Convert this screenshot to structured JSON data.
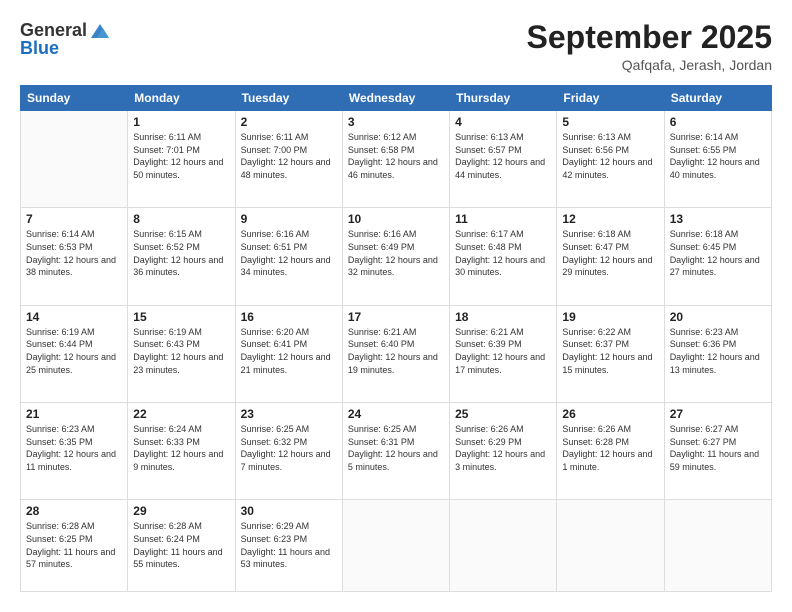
{
  "logo": {
    "general": "General",
    "blue": "Blue"
  },
  "header": {
    "month_year": "September 2025",
    "location": "Qafqafa, Jerash, Jordan"
  },
  "weekdays": [
    "Sunday",
    "Monday",
    "Tuesday",
    "Wednesday",
    "Thursday",
    "Friday",
    "Saturday"
  ],
  "weeks": [
    [
      {
        "day": "",
        "sunrise": "",
        "sunset": "",
        "daylight": ""
      },
      {
        "day": "1",
        "sunrise": "Sunrise: 6:11 AM",
        "sunset": "Sunset: 7:01 PM",
        "daylight": "Daylight: 12 hours and 50 minutes."
      },
      {
        "day": "2",
        "sunrise": "Sunrise: 6:11 AM",
        "sunset": "Sunset: 7:00 PM",
        "daylight": "Daylight: 12 hours and 48 minutes."
      },
      {
        "day": "3",
        "sunrise": "Sunrise: 6:12 AM",
        "sunset": "Sunset: 6:58 PM",
        "daylight": "Daylight: 12 hours and 46 minutes."
      },
      {
        "day": "4",
        "sunrise": "Sunrise: 6:13 AM",
        "sunset": "Sunset: 6:57 PM",
        "daylight": "Daylight: 12 hours and 44 minutes."
      },
      {
        "day": "5",
        "sunrise": "Sunrise: 6:13 AM",
        "sunset": "Sunset: 6:56 PM",
        "daylight": "Daylight: 12 hours and 42 minutes."
      },
      {
        "day": "6",
        "sunrise": "Sunrise: 6:14 AM",
        "sunset": "Sunset: 6:55 PM",
        "daylight": "Daylight: 12 hours and 40 minutes."
      }
    ],
    [
      {
        "day": "7",
        "sunrise": "Sunrise: 6:14 AM",
        "sunset": "Sunset: 6:53 PM",
        "daylight": "Daylight: 12 hours and 38 minutes."
      },
      {
        "day": "8",
        "sunrise": "Sunrise: 6:15 AM",
        "sunset": "Sunset: 6:52 PM",
        "daylight": "Daylight: 12 hours and 36 minutes."
      },
      {
        "day": "9",
        "sunrise": "Sunrise: 6:16 AM",
        "sunset": "Sunset: 6:51 PM",
        "daylight": "Daylight: 12 hours and 34 minutes."
      },
      {
        "day": "10",
        "sunrise": "Sunrise: 6:16 AM",
        "sunset": "Sunset: 6:49 PM",
        "daylight": "Daylight: 12 hours and 32 minutes."
      },
      {
        "day": "11",
        "sunrise": "Sunrise: 6:17 AM",
        "sunset": "Sunset: 6:48 PM",
        "daylight": "Daylight: 12 hours and 30 minutes."
      },
      {
        "day": "12",
        "sunrise": "Sunrise: 6:18 AM",
        "sunset": "Sunset: 6:47 PM",
        "daylight": "Daylight: 12 hours and 29 minutes."
      },
      {
        "day": "13",
        "sunrise": "Sunrise: 6:18 AM",
        "sunset": "Sunset: 6:45 PM",
        "daylight": "Daylight: 12 hours and 27 minutes."
      }
    ],
    [
      {
        "day": "14",
        "sunrise": "Sunrise: 6:19 AM",
        "sunset": "Sunset: 6:44 PM",
        "daylight": "Daylight: 12 hours and 25 minutes."
      },
      {
        "day": "15",
        "sunrise": "Sunrise: 6:19 AM",
        "sunset": "Sunset: 6:43 PM",
        "daylight": "Daylight: 12 hours and 23 minutes."
      },
      {
        "day": "16",
        "sunrise": "Sunrise: 6:20 AM",
        "sunset": "Sunset: 6:41 PM",
        "daylight": "Daylight: 12 hours and 21 minutes."
      },
      {
        "day": "17",
        "sunrise": "Sunrise: 6:21 AM",
        "sunset": "Sunset: 6:40 PM",
        "daylight": "Daylight: 12 hours and 19 minutes."
      },
      {
        "day": "18",
        "sunrise": "Sunrise: 6:21 AM",
        "sunset": "Sunset: 6:39 PM",
        "daylight": "Daylight: 12 hours and 17 minutes."
      },
      {
        "day": "19",
        "sunrise": "Sunrise: 6:22 AM",
        "sunset": "Sunset: 6:37 PM",
        "daylight": "Daylight: 12 hours and 15 minutes."
      },
      {
        "day": "20",
        "sunrise": "Sunrise: 6:23 AM",
        "sunset": "Sunset: 6:36 PM",
        "daylight": "Daylight: 12 hours and 13 minutes."
      }
    ],
    [
      {
        "day": "21",
        "sunrise": "Sunrise: 6:23 AM",
        "sunset": "Sunset: 6:35 PM",
        "daylight": "Daylight: 12 hours and 11 minutes."
      },
      {
        "day": "22",
        "sunrise": "Sunrise: 6:24 AM",
        "sunset": "Sunset: 6:33 PM",
        "daylight": "Daylight: 12 hours and 9 minutes."
      },
      {
        "day": "23",
        "sunrise": "Sunrise: 6:25 AM",
        "sunset": "Sunset: 6:32 PM",
        "daylight": "Daylight: 12 hours and 7 minutes."
      },
      {
        "day": "24",
        "sunrise": "Sunrise: 6:25 AM",
        "sunset": "Sunset: 6:31 PM",
        "daylight": "Daylight: 12 hours and 5 minutes."
      },
      {
        "day": "25",
        "sunrise": "Sunrise: 6:26 AM",
        "sunset": "Sunset: 6:29 PM",
        "daylight": "Daylight: 12 hours and 3 minutes."
      },
      {
        "day": "26",
        "sunrise": "Sunrise: 6:26 AM",
        "sunset": "Sunset: 6:28 PM",
        "daylight": "Daylight: 12 hours and 1 minute."
      },
      {
        "day": "27",
        "sunrise": "Sunrise: 6:27 AM",
        "sunset": "Sunset: 6:27 PM",
        "daylight": "Daylight: 11 hours and 59 minutes."
      }
    ],
    [
      {
        "day": "28",
        "sunrise": "Sunrise: 6:28 AM",
        "sunset": "Sunset: 6:25 PM",
        "daylight": "Daylight: 11 hours and 57 minutes."
      },
      {
        "day": "29",
        "sunrise": "Sunrise: 6:28 AM",
        "sunset": "Sunset: 6:24 PM",
        "daylight": "Daylight: 11 hours and 55 minutes."
      },
      {
        "day": "30",
        "sunrise": "Sunrise: 6:29 AM",
        "sunset": "Sunset: 6:23 PM",
        "daylight": "Daylight: 11 hours and 53 minutes."
      },
      {
        "day": "",
        "sunrise": "",
        "sunset": "",
        "daylight": ""
      },
      {
        "day": "",
        "sunrise": "",
        "sunset": "",
        "daylight": ""
      },
      {
        "day": "",
        "sunrise": "",
        "sunset": "",
        "daylight": ""
      },
      {
        "day": "",
        "sunrise": "",
        "sunset": "",
        "daylight": ""
      }
    ]
  ]
}
